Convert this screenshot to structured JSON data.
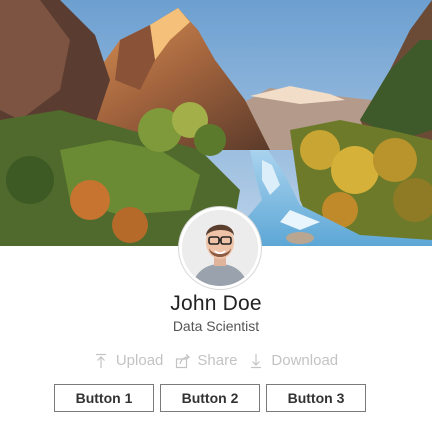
{
  "profile": {
    "name": "John Doe",
    "title": "Data Scientist"
  },
  "actions": [
    {
      "label": "Upload",
      "icon": "upload-icon"
    },
    {
      "label": "Share",
      "icon": "share-icon"
    },
    {
      "label": "Download",
      "icon": "download-icon"
    }
  ],
  "buttons": [
    {
      "label": "Button 1"
    },
    {
      "label": "Button 2"
    },
    {
      "label": "Button 3"
    }
  ],
  "colors": {
    "action_text": "#c3c3c3",
    "name_text": "#222222",
    "button_border": "#7a7a7a"
  }
}
